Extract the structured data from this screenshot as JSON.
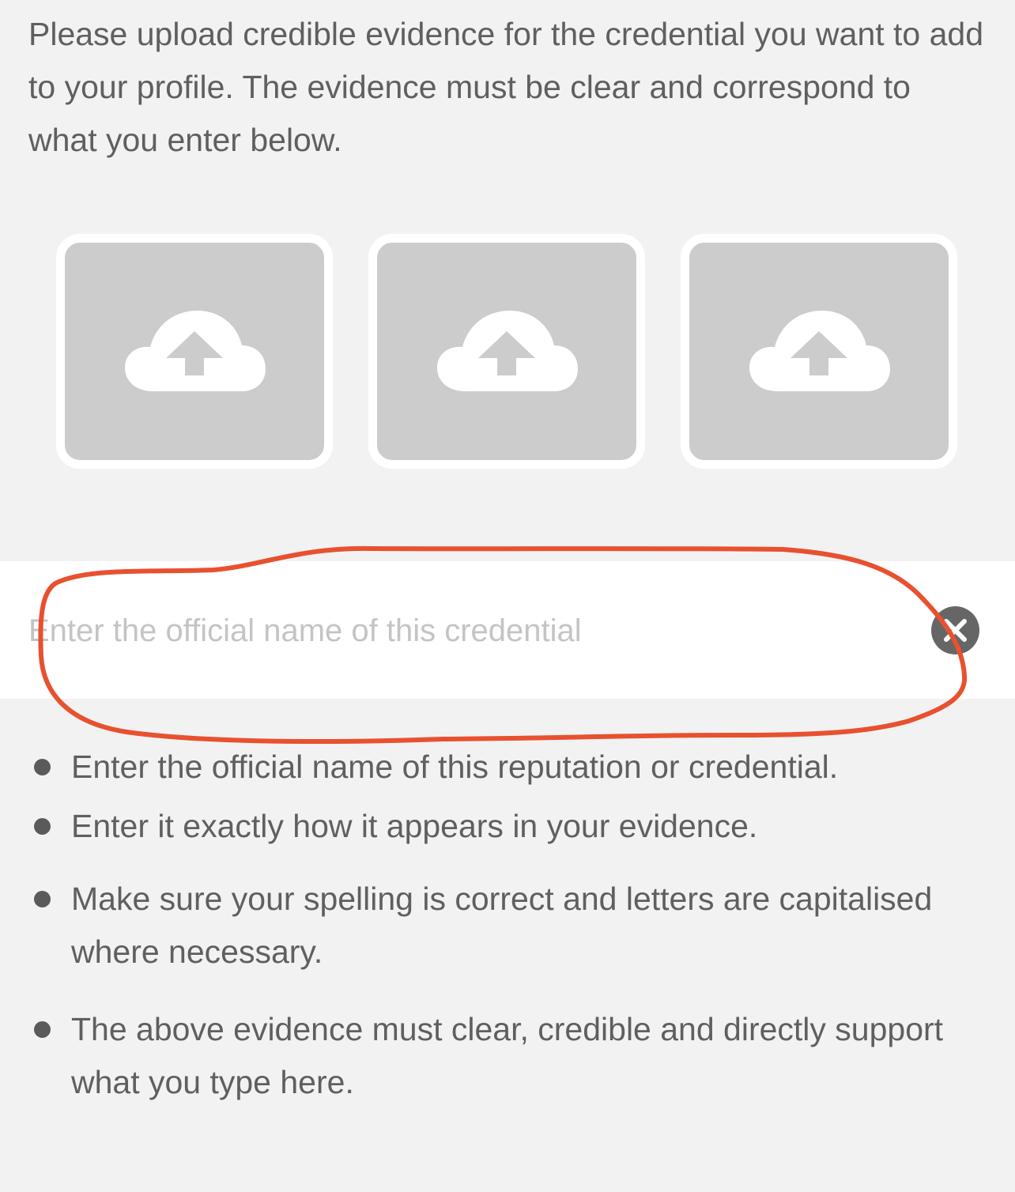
{
  "intro": {
    "text": "Please upload credible evidence for the credential you want to add to your profile. The evidence must be clear and correspond to what you enter below."
  },
  "upload_slots": [
    {
      "icon": "cloud-upload-icon"
    },
    {
      "icon": "cloud-upload-icon"
    },
    {
      "icon": "cloud-upload-icon"
    }
  ],
  "credential_input": {
    "placeholder": "Enter the official name of this credential",
    "value": "",
    "clear_icon": "clear-circle-x-icon"
  },
  "guidelines": [
    "Enter the official name of this reputation or credential.",
    "Enter it exactly how it appears in your evidence.",
    "Make sure your spelling is correct and letters are capitalised where necessary.",
    "The above evidence must clear, credible and directly support what you type here."
  ],
  "colors": {
    "background": "#f2f2f2",
    "upload_tile": "#cccccc",
    "tile_border": "#ffffff",
    "text": "#5f5f5f",
    "placeholder": "#c4c4c4",
    "clear_button": "#666666",
    "annotation_stroke": "#e8512f"
  }
}
